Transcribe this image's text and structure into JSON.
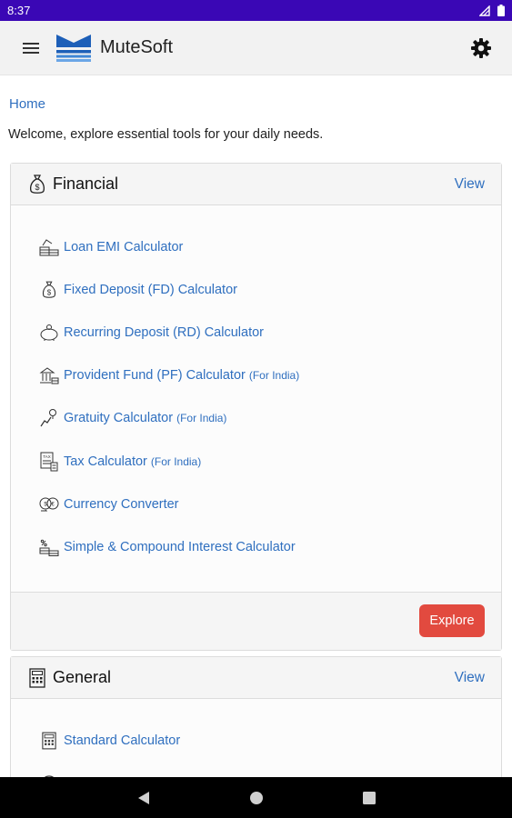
{
  "status_bar": {
    "time": "8:37"
  },
  "app_bar": {
    "title": "MuteSoft",
    "logo_icon": "mutesoft-logo",
    "menu_icon": "hamburger-menu-icon",
    "settings_icon": "gear-icon"
  },
  "breadcrumb": "Home",
  "welcome_text": "Welcome, explore essential tools for your daily needs.",
  "financial": {
    "title": "Financial",
    "view_label": "View",
    "explore_label": "Explore",
    "items": [
      {
        "label": "Loan EMI Calculator",
        "note": ""
      },
      {
        "label": "Fixed Deposit (FD) Calculator",
        "note": ""
      },
      {
        "label": "Recurring Deposit (RD) Calculator",
        "note": ""
      },
      {
        "label": "Provident Fund (PF) Calculator",
        "note": "(For India)"
      },
      {
        "label": "Gratuity Calculator",
        "note": "(For India)"
      },
      {
        "label": "Tax Calculator",
        "note": "(For India)"
      },
      {
        "label": "Currency Converter",
        "note": ""
      },
      {
        "label": "Simple & Compound Interest Calculator",
        "note": ""
      }
    ]
  },
  "general": {
    "title": "General",
    "view_label": "View",
    "items": [
      {
        "label": "Standard Calculator",
        "note": ""
      }
    ]
  },
  "colors": {
    "status_bar": "#3a07b5",
    "link": "#2f6fbf",
    "explore_button": "#e24a3f"
  }
}
